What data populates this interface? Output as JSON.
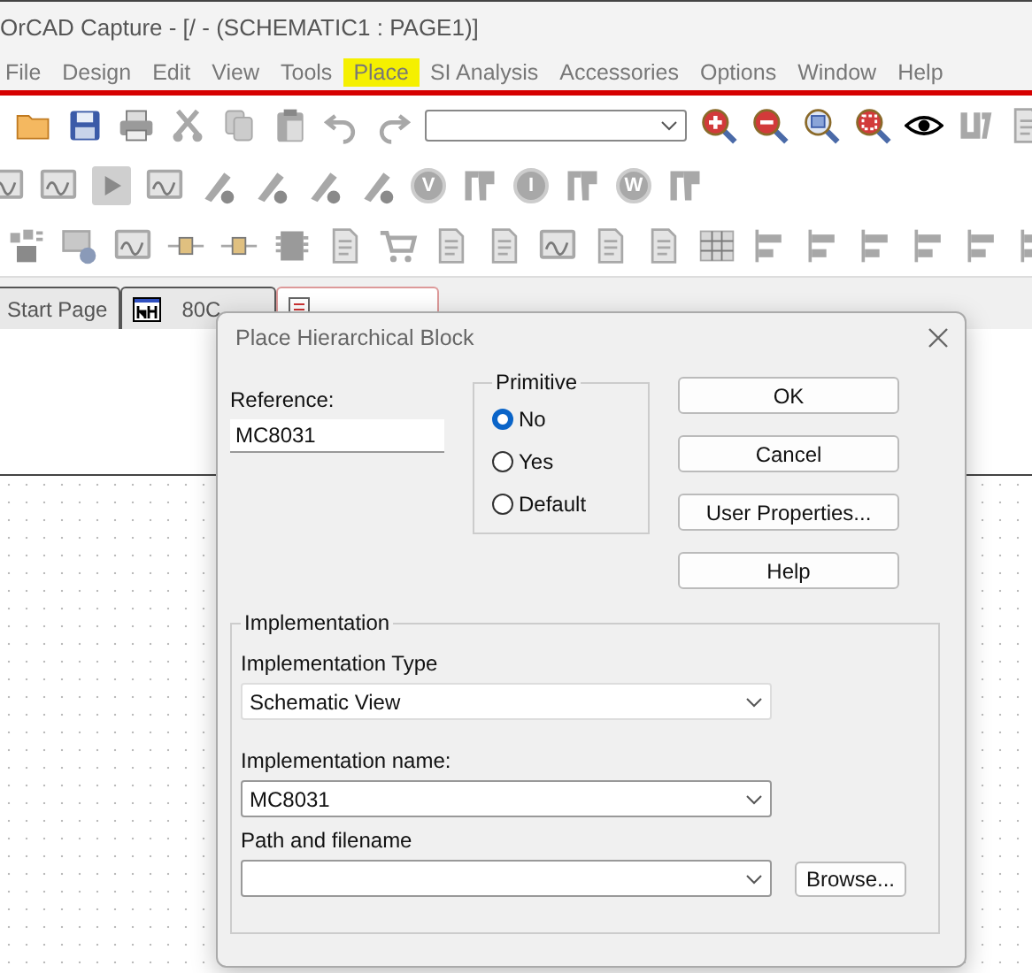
{
  "window": {
    "title": "OrCAD Capture - [/ - (SCHEMATIC1 : PAGE1)]"
  },
  "menu": [
    {
      "label": "File",
      "selected": false
    },
    {
      "label": "Design",
      "selected": false
    },
    {
      "label": "Edit",
      "selected": false
    },
    {
      "label": "View",
      "selected": false
    },
    {
      "label": "Tools",
      "selected": false
    },
    {
      "label": "Place",
      "selected": true
    },
    {
      "label": "SI Analysis",
      "selected": false
    },
    {
      "label": "Accessories",
      "selected": false
    },
    {
      "label": "Options",
      "selected": false
    },
    {
      "label": "Window",
      "selected": false
    },
    {
      "label": "Help",
      "selected": false
    }
  ],
  "toolbar_1": [
    {
      "kind": "folder"
    },
    {
      "kind": "floppy"
    },
    {
      "kind": "printer"
    },
    {
      "kind": "scissors"
    },
    {
      "kind": "copy"
    },
    {
      "kind": "paste"
    },
    {
      "kind": "undo"
    },
    {
      "kind": "redo"
    },
    {
      "kind": "combo"
    },
    {
      "kind": "zoom-in"
    },
    {
      "kind": "zoom-out"
    },
    {
      "kind": "zoom-area"
    },
    {
      "kind": "zoom-fit"
    },
    {
      "kind": "eye"
    },
    {
      "kind": "part"
    },
    {
      "kind": "document"
    }
  ],
  "toolbar_2": [
    {
      "kind": "chart"
    },
    {
      "kind": "chart"
    },
    {
      "kind": "play"
    },
    {
      "kind": "chart"
    },
    {
      "kind": "probe"
    },
    {
      "kind": "probe"
    },
    {
      "kind": "probe"
    },
    {
      "kind": "probe"
    },
    {
      "kind": "meter",
      "label": "V"
    },
    {
      "kind": "marker"
    },
    {
      "kind": "meter",
      "label": "I"
    },
    {
      "kind": "marker"
    },
    {
      "kind": "meter",
      "label": "W"
    },
    {
      "kind": "marker"
    }
  ],
  "toolbar_3": [
    {
      "kind": "grid"
    },
    {
      "kind": "monitor"
    },
    {
      "kind": "chart"
    },
    {
      "kind": "connector"
    },
    {
      "kind": "connector"
    },
    {
      "kind": "chip"
    },
    {
      "kind": "document"
    },
    {
      "kind": "cart"
    },
    {
      "kind": "document"
    },
    {
      "kind": "document"
    },
    {
      "kind": "chart"
    },
    {
      "kind": "document"
    },
    {
      "kind": "document"
    },
    {
      "kind": "table"
    },
    {
      "kind": "align"
    },
    {
      "kind": "align"
    },
    {
      "kind": "align"
    },
    {
      "kind": "align"
    },
    {
      "kind": "align"
    },
    {
      "kind": "align"
    }
  ],
  "tabs": [
    {
      "label": "Start Page",
      "selected": false
    },
    {
      "label": "80C",
      "selected": false,
      "kind": "schematic"
    },
    {
      "selected": true,
      "kind": "page"
    }
  ],
  "dialog": {
    "title": "Place Hierarchical Block",
    "reference": {
      "label": "Reference:",
      "value": "MC8031"
    },
    "primitive": {
      "title": "Primitive",
      "options": [
        {
          "label": "No",
          "selected": true
        },
        {
          "label": "Yes",
          "selected": false
        },
        {
          "label": "Default",
          "selected": false
        }
      ]
    },
    "buttons": [
      "OK",
      "Cancel",
      "User Properties...",
      "Help"
    ],
    "implementation": {
      "title": "Implementation",
      "type": {
        "label": "Implementation Type",
        "value": "Schematic View"
      },
      "name": {
        "label": "Implementation name:",
        "value": "MC8031"
      },
      "path": {
        "label": "Path and filename"
      },
      "browse": "Browse..."
    }
  }
}
